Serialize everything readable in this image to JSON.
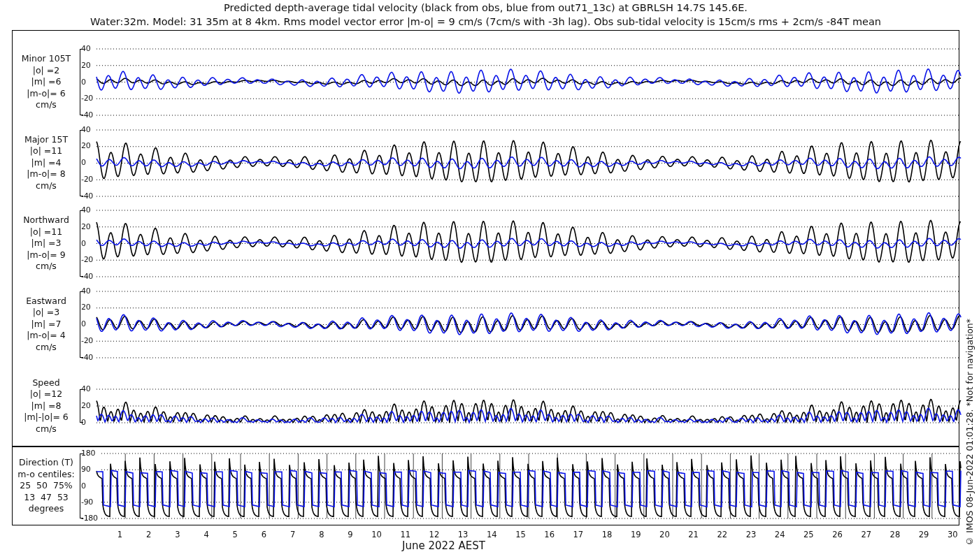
{
  "title_lines": [
    "Predicted depth-average tidal velocity (black from obs, blue from out71_13c) at GBRLSH 14.7S 145.6E.",
    "Water:32m. Model: 31 35m at 8 4km. Rms model vector error |m-o| = 9 cm/s (7cm/s with -3h lag). Obs sub-tidal velocity is 15cm/s rms + 2cm/s -84T mean"
  ],
  "panels": [
    {
      "kind": "velocity",
      "label_lines": [
        "Minor 105T",
        "|o| =2",
        "|m| =6",
        "|m-o|= 6",
        "cm/s"
      ],
      "yticks": [
        "40",
        "20",
        "0",
        "-20",
        "-40"
      ]
    },
    {
      "kind": "velocity",
      "label_lines": [
        "Major 15T",
        "|o| =11",
        "|m| =4",
        "|m-o|= 8",
        "cm/s"
      ],
      "yticks": [
        "40",
        "20",
        "0",
        "-20",
        "-40"
      ]
    },
    {
      "kind": "velocity",
      "label_lines": [
        "Northward",
        "|o| =11",
        "|m| =3",
        "|m-o|= 9",
        "cm/s"
      ],
      "yticks": [
        "40",
        "20",
        "0",
        "-20",
        "-40"
      ]
    },
    {
      "kind": "velocity",
      "label_lines": [
        "Eastward",
        "|o| =3",
        "|m| =7",
        "|m-o|= 4",
        "cm/s"
      ],
      "yticks": [
        "40",
        "20",
        "0",
        "-20",
        "-40"
      ]
    },
    {
      "kind": "speed",
      "label_lines": [
        "Speed",
        "|o| =12",
        "|m| =8",
        "|m|-|o|= 6",
        "cm/s"
      ],
      "yticks": [
        "40",
        "20",
        "0"
      ]
    },
    {
      "kind": "direction",
      "label_lines": [
        "Direction (T)",
        "m-o centiles:",
        "25  50  75%",
        "13  47  53",
        "degrees"
      ],
      "yticks": [
        "180",
        "90",
        "0",
        "-90",
        "-180"
      ]
    }
  ],
  "day_ticks": [
    "1",
    "2",
    "3",
    "4",
    "5",
    "6",
    "7",
    "8",
    "9",
    "10",
    "11",
    "12",
    "13",
    "14",
    "15",
    "16",
    "17",
    "18",
    "19",
    "20",
    "21",
    "22",
    "23",
    "24",
    "25",
    "26",
    "27",
    "28",
    "29",
    "30"
  ],
  "xlabel": "June 2022 AEST",
  "credit": "© IMOS 08-Jun-2022 01:01:28. *Not for navigation*"
}
